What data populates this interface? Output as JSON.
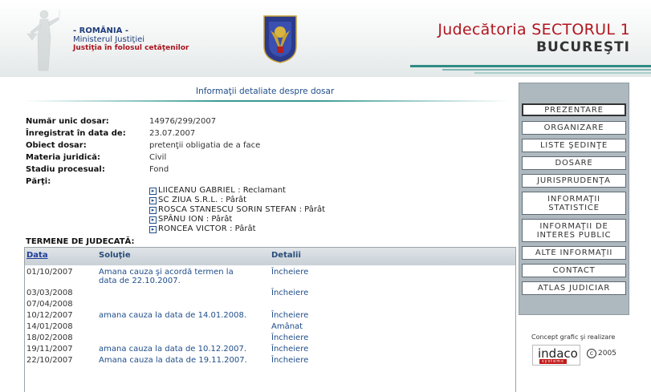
{
  "header": {
    "country": "ROMÂNIA",
    "ministry": "Ministerul Justiţiei",
    "motto": "Justiţia în folosul cetăţenilor",
    "court_name": "Judecătoria SECTORUL 1",
    "city": "BUCUREŞTI",
    "emblem_caption": "ROMANIA"
  },
  "page_title": "Informaţii detaliate despre dosar",
  "dosar": {
    "numar_label": "Număr unic dosar:",
    "numar_value": "14976/299/2007",
    "inregistrat_label": "Înregistrat în data de:",
    "inregistrat_value": "23.07.2007",
    "obiect_label": "Obiect dosar:",
    "obiect_value": "pretenţii obligatia de a face",
    "materia_label": "Materia juridică:",
    "materia_value": "Civil",
    "stadiu_label": "Stadiu procesual:",
    "stadiu_value": "Fond",
    "parti_label": "Părţi:"
  },
  "parties": [
    {
      "name": "LIICEANU GABRIEL",
      "role": "Reclamant"
    },
    {
      "name": "SC ZIUA S.R.L.",
      "role": "Pârât"
    },
    {
      "name": "ROSCA STANESCU SORIN STEFAN",
      "role": "Pârât"
    },
    {
      "name": "SPÂNU ION",
      "role": "Pârât"
    },
    {
      "name": "RONCEA VICTOR",
      "role": "Pârât"
    }
  ],
  "termene": {
    "title": "TERMENE DE JUDECATĂ:",
    "columns": {
      "data": "Data",
      "solutie": "Soluţie",
      "detalii": "Detalii"
    },
    "rows": [
      {
        "data": "01/10/2007",
        "solutie_l1": "Amana cauza şi acordă termen la",
        "solutie_l2": "data de 22.10.2007.",
        "detalii": "Încheiere"
      },
      {
        "data": "03/03/2008",
        "solutie_l1": "",
        "solutie_l2": "",
        "detalii": "Încheiere"
      },
      {
        "data": "07/04/2008",
        "solutie_l1": "",
        "solutie_l2": "",
        "detalii": ""
      },
      {
        "data": "10/12/2007",
        "solutie_l1": "amana cauza la data de 14.01.2008.",
        "solutie_l2": "",
        "detalii": "Încheiere"
      },
      {
        "data": "14/01/2008",
        "solutie_l1": "",
        "solutie_l2": "",
        "detalii": "Amânat"
      },
      {
        "data": "18/02/2008",
        "solutie_l1": "",
        "solutie_l2": "",
        "detalii": "Încheiere"
      },
      {
        "data": "19/11/2007",
        "solutie_l1": "amana cauza la data de 10.12.2007.",
        "solutie_l2": "",
        "detalii": "Încheiere"
      },
      {
        "data": "22/10/2007",
        "solutie_l1": "Amana cauza la data de 19.11.2007.",
        "solutie_l2": "",
        "detalii": "Încheiere"
      }
    ]
  },
  "sidebar": {
    "items": [
      {
        "label": "PREZENTARE"
      },
      {
        "label": "ORGANIZARE"
      },
      {
        "label": "LISTE ŞEDINŢE"
      },
      {
        "label": "DOSARE"
      },
      {
        "label": "JURISPRUDENŢA"
      },
      {
        "label_l1": "INFORMAŢII",
        "label_l2": "STATISTICE"
      },
      {
        "label_l1": "INFORMAŢII DE",
        "label_l2": "INTERES PUBLIC"
      },
      {
        "label": "ALTE INFORMAŢII"
      },
      {
        "label": "CONTACT"
      },
      {
        "label": "ATLAS JUDICIAR"
      }
    ]
  },
  "footer": {
    "credit": "Concept grafic şi realizare",
    "logo": "indaco",
    "logo_sub": "systems",
    "copyright_symbol": "c",
    "year": "2005"
  },
  "colors": {
    "court_red": "#b2161e",
    "link_blue": "#1f4d88",
    "teal_rule": "#3a9a94",
    "sidebar_gray": "#aeb8bf"
  }
}
